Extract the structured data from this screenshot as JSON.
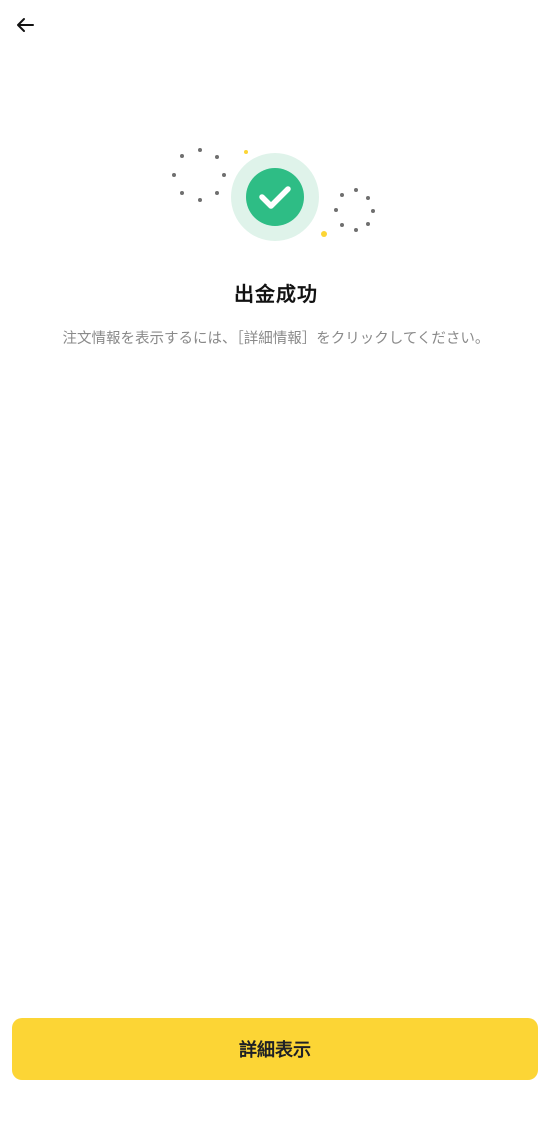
{
  "header": {
    "back_icon": "arrow-left-icon"
  },
  "status": {
    "icon": "check-circle-icon",
    "accent_color": "#2ebd85",
    "title": "出金成功",
    "message": "注文情報を表示するには、［詳細情報］をクリックしてください。"
  },
  "footer": {
    "details_label": "詳細表示",
    "button_color": "#fcd535"
  }
}
